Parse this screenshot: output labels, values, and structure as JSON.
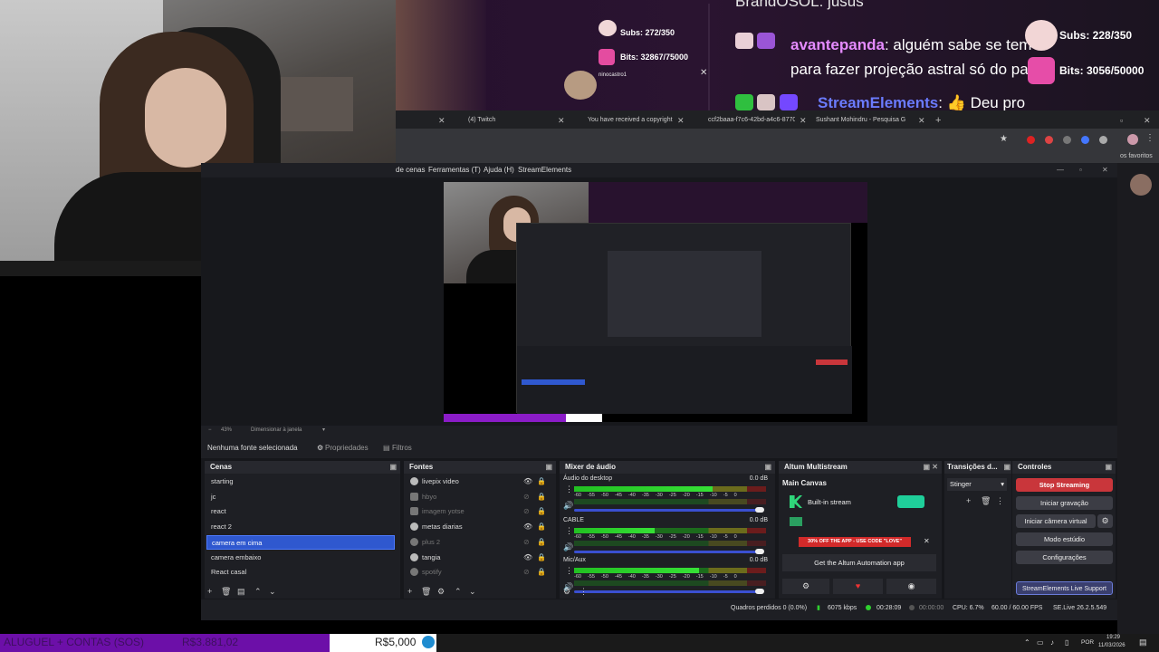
{
  "overlay": {
    "subs_small": "Subs: 272/350",
    "bits_small": "Bits: 32867/75000",
    "chatter_small": "ninocastro1",
    "subs_big": "Subs: 228/350",
    "bits_big": "Bits: 3056/50000",
    "chat_top_partial": "BrandOSOL: jusus",
    "chat1_name": "avantepanda",
    "chat1_text": ": alguém sabe se tem para fazer projeção astral só do pau?",
    "chat2_name": "StreamElements",
    "chat2_text": ": 👍 Deu pro"
  },
  "browser": {
    "tabs": [
      {
        "label": "(4) Twitch"
      },
      {
        "label": "You have received a copyright"
      },
      {
        "label": "ccf2baaa-f7c6-42bd-a4c6-8770"
      },
      {
        "label": "Sushant Mohindru - Pesquisa G"
      }
    ],
    "new_tab": "+",
    "favorites": "os favoritos"
  },
  "obs": {
    "menu": [
      "de cenas",
      "Ferramentas (T)",
      "Ajuda (H)",
      "StreamElements"
    ],
    "zoom": "43%",
    "fit_label": "Dimensionar à janela",
    "no_source": "Nenhuma fonte selecionada",
    "properties": "Propriedades",
    "filters": "Filtros",
    "scenes_title": "Cenas",
    "scenes": [
      "starting",
      "jc",
      "react",
      "react 2",
      "camera em cima",
      "camera embaixo",
      "React casal"
    ],
    "selected_scene": "camera em cima",
    "sources_title": "Fontes",
    "sources": [
      {
        "name": "livepix video",
        "dim": false
      },
      {
        "name": "hbyo",
        "dim": true
      },
      {
        "name": "imagem yotse",
        "dim": true
      },
      {
        "name": "metas diarias",
        "dim": false
      },
      {
        "name": "plus 2",
        "dim": true
      },
      {
        "name": "tangia",
        "dim": false
      },
      {
        "name": "spotify",
        "dim": true
      }
    ],
    "mixer_title": "Mixer de áudio",
    "mixer": [
      {
        "name": "Áudio do desktop",
        "db": "0.0 dB",
        "level": 0.72
      },
      {
        "name": "CABLE",
        "db": "0.0 dB",
        "level": 0.42
      },
      {
        "name": "Mic/Aux",
        "db": "0.0 dB",
        "level": 0.65
      }
    ],
    "mixer_scale": "-60 -55 -50 -45 -40 -35 -30 -25 -20 -15 -10 -5 0",
    "altum_title": "Altum Multistream",
    "main_canvas": "Main Canvas",
    "builtin_stream": "Built-in stream",
    "promo": "30% OFF THE APP - USE CODE \"LOVE\"",
    "get_app": "Get the Altum Automation app",
    "transitions_title": "Transições d...",
    "transition": "Stinger",
    "controls_title": "Controles",
    "controls": {
      "stop_streaming": "Stop Streaming",
      "start_recording": "Iniciar gravação",
      "virtual_cam": "Iniciar câmera virtual",
      "studio_mode": "Modo estúdio",
      "settings": "Configurações",
      "support": "StreamElements Live Support"
    },
    "status": {
      "frames": "Quadros perdidos 0 (0.0%)",
      "kbps": "6075 kbps",
      "live_time": "00:28:09",
      "rec_time": "00:00:00",
      "cpu": "CPU: 6.7%",
      "fps": "60.00 / 60.00 FPS",
      "version": "SE.Live 26.2.5.549"
    }
  },
  "bottom": {
    "aluguel": "ALUGUEL + CONTAS (SOS)",
    "amount_left": "R$3.881,02",
    "amount_goal": "R$5,000",
    "lang": "POR",
    "time": "19:29",
    "date": "11/03/2026"
  },
  "colors": {
    "accent_blue": "#2f58cf",
    "stop_red": "#c9363b",
    "purple_bar": "#6c0fa8",
    "meter_green": "#22c022"
  }
}
